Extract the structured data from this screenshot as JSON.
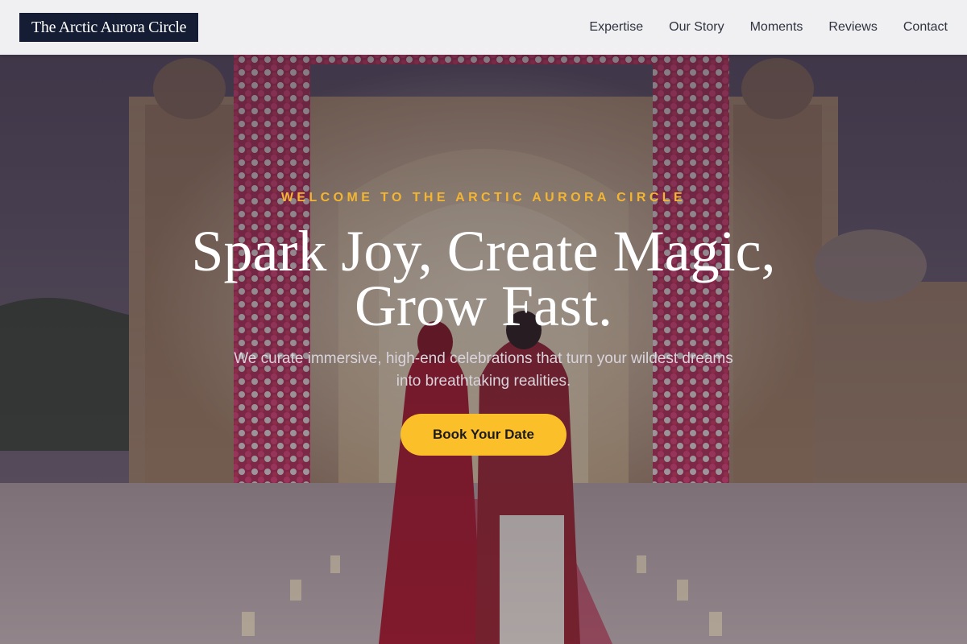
{
  "brand": {
    "name": "The Arctic Aurora Circle"
  },
  "nav": {
    "items": [
      {
        "label": "Expertise"
      },
      {
        "label": "Our Story"
      },
      {
        "label": "Moments"
      },
      {
        "label": "Reviews"
      },
      {
        "label": "Contact"
      }
    ]
  },
  "hero": {
    "eyebrow": "WELCOME TO THE ARCTIC AURORA CIRCLE",
    "headline_line1": "Spark Joy, Create Magic,",
    "headline_line2": "Grow Fast.",
    "subtitle": "We curate immersive, high-end celebrations that turn your wildest dreams into breathtaking realities.",
    "cta_label": "Book Your Date"
  },
  "colors": {
    "accent": "#fbbf2a",
    "eyebrow": "#f4b532",
    "logo_bg": "#141d33",
    "nav_bg": "#f6f6f8",
    "nav_text": "#2f3440"
  }
}
